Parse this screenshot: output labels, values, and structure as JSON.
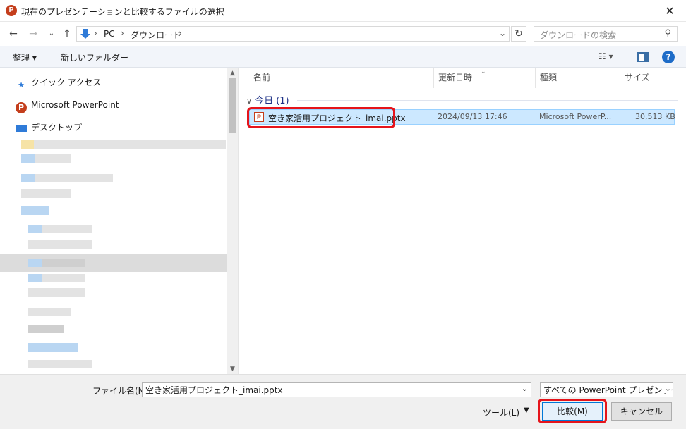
{
  "window": {
    "title": "現在のプレゼンテーションと比較するファイルの選択",
    "app_icon": "P",
    "close_glyph": "✕"
  },
  "address_bar": {
    "crumbs": [
      "PC",
      "ダウンロード"
    ],
    "search_placeholder": "ダウンロードの検索"
  },
  "toolbar": {
    "organize_label": "整理 ▾",
    "new_folder_label": "新しいフォルダー",
    "help_label": "?"
  },
  "nav": {
    "items": [
      {
        "label": "クイック アクセス",
        "icon": "star-icon"
      },
      {
        "label": "Microsoft PowerPoint",
        "icon": "powerpoint-icon"
      },
      {
        "label": "デスクトップ",
        "icon": "desktop-icon"
      }
    ]
  },
  "columns": [
    "名前",
    "更新日時",
    "種類",
    "サイズ"
  ],
  "group": {
    "label": "今日 (1)"
  },
  "files": [
    {
      "name": "空き家活用プロジェクト_imai.pptx",
      "modified": "2024/09/13 17:46",
      "type": "Microsoft PowerP...",
      "size": "30,513 KB"
    }
  ],
  "bottom": {
    "filename_label": "ファイル名(N):",
    "filename_value": "空き家活用プロジェクト_imai.pptx",
    "filter_value": "すべての PowerPoint プレゼンテーション",
    "tools_label": "ツール(L)",
    "compare_button": "比較(M)",
    "cancel_button": "キャンセル"
  },
  "colors": {
    "highlight": "#e5141b",
    "selection": "#cce8ff",
    "powerpoint": "#c43e1c"
  }
}
